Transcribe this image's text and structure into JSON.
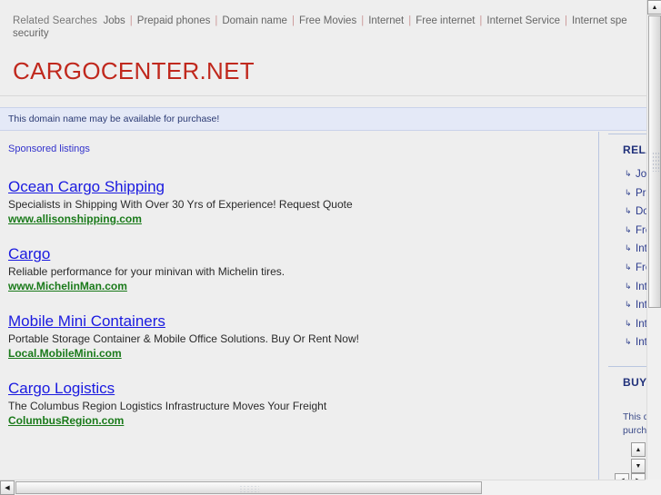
{
  "related_searches": {
    "label": "Related Searches",
    "items": [
      "Jobs",
      "Prepaid phones",
      "Domain name",
      "Free Movies",
      "Internet",
      "Free internet",
      "Internet Service",
      "Internet spe"
    ],
    "second_line": "security",
    "separator": "|"
  },
  "domain": {
    "title": "CARGOCENTER.NET"
  },
  "banner": {
    "text": "This domain name may be available for purchase!"
  },
  "listings": {
    "heading": "Sponsored listings",
    "ads": [
      {
        "title": "Ocean Cargo Shipping",
        "description": "Specialists in Shipping With Over 30 Yrs of Experience! Request Quote",
        "url": "www.allisonshipping.com"
      },
      {
        "title": "Cargo",
        "description": "Reliable performance for your minivan with Michelin tires.",
        "url": "www.MichelinMan.com"
      },
      {
        "title": "Mobile Mini Containers",
        "description": "Portable Storage Container & Mobile Office Solutions. Buy Or Rent Now!",
        "url": "Local.MobileMini.com"
      },
      {
        "title": "Cargo Logistics",
        "description": "The Columbus Region Logistics Infrastructure Moves Your Freight",
        "url": "ColumbusRegion.com"
      }
    ]
  },
  "sidebar": {
    "related_heading": "RELATED SEARCHES",
    "bullet": "↳",
    "items": [
      "Jobs",
      "Prepaid phones",
      "Domain name",
      "Free Movies",
      "Internet",
      "Free internet",
      "Internet Service",
      "Internet security",
      "Internet speed",
      "Internet provider"
    ],
    "buy_heading": "BUY THIS DOMAIN",
    "buy_text": "This domain name may be available for purchase!"
  },
  "scrollbars": {
    "up_arrow": "▲",
    "down_arrow": "▼",
    "left_arrow": "◀",
    "right_arrow": "▶"
  },
  "colors": {
    "title_red": "#c0281d",
    "link_blue": "#1a1ae0",
    "url_green": "#1a7a1a",
    "sidebar_navy": "#2b3a8c",
    "banner_bg": "#e4e9f7",
    "page_bg": "#eeeeee"
  }
}
